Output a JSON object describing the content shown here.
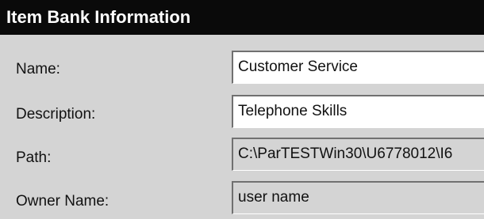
{
  "header": {
    "title": "Item Bank Information"
  },
  "fields": [
    {
      "label": "Name:",
      "value": "Customer Service"
    },
    {
      "label": "Description:",
      "value": "Telephone Skills"
    },
    {
      "label": "Path:",
      "value": "C:\\ParTESTWin30\\U6778012\\I6"
    },
    {
      "label": "Owner Name:",
      "value": "user name"
    }
  ],
  "colors": {
    "header_bg": "#0a0a0a",
    "panel_bg": "#d4d4d4",
    "field_bg_editable": "#ffffff",
    "field_bg_readonly": "#d4d4d4"
  }
}
